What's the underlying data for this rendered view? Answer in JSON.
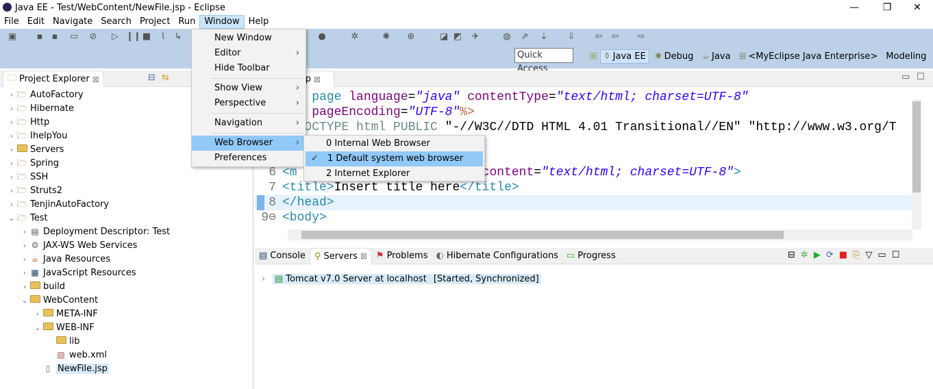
{
  "window": {
    "title": "Java EE - Test/WebContent/NewFile.jsp - Eclipse",
    "minimize": "—",
    "maximize": "❐",
    "close": "✕"
  },
  "menubar": [
    "File",
    "Edit",
    "Navigate",
    "Search",
    "Project",
    "Run",
    "Window",
    "Help"
  ],
  "quick_access": "Quick Access",
  "perspectives": [
    {
      "label": "Java EE",
      "active": true
    },
    {
      "label": "Debug"
    },
    {
      "label": "Java"
    },
    {
      "label": "<MyEclipse Java Enterprise>"
    },
    {
      "label": "Modeling"
    }
  ],
  "project_explorer": {
    "title": "Project Explorer",
    "items": [
      {
        "label": "AutoFactory",
        "level": 0,
        "exp": "›",
        "icon": "project"
      },
      {
        "label": "Hibernate",
        "level": 0,
        "exp": "›",
        "icon": "project"
      },
      {
        "label": "Http",
        "level": 0,
        "exp": "›",
        "icon": "project"
      },
      {
        "label": "IhelpYou",
        "level": 0,
        "exp": "›",
        "icon": "project"
      },
      {
        "label": "Servers",
        "level": 0,
        "exp": "›",
        "icon": "folder"
      },
      {
        "label": "Spring",
        "level": 0,
        "exp": "›",
        "icon": "project"
      },
      {
        "label": "SSH",
        "level": 0,
        "exp": "›",
        "icon": "project"
      },
      {
        "label": "Struts2",
        "level": 0,
        "exp": "›",
        "icon": "project"
      },
      {
        "label": "TenjinAutoFactory",
        "level": 0,
        "exp": "›",
        "icon": "project"
      },
      {
        "label": "Test",
        "level": 0,
        "exp": "⌄",
        "icon": "project"
      },
      {
        "label": "Deployment Descriptor: Test",
        "level": 1,
        "exp": "›",
        "icon": "descriptor"
      },
      {
        "label": "JAX-WS Web Services",
        "level": 1,
        "exp": "›",
        "icon": "ws"
      },
      {
        "label": "Java Resources",
        "level": 1,
        "exp": "›",
        "icon": "jres"
      },
      {
        "label": "JavaScript Resources",
        "level": 1,
        "exp": "›",
        "icon": "js"
      },
      {
        "label": "build",
        "level": 1,
        "exp": "›",
        "icon": "folder"
      },
      {
        "label": "WebContent",
        "level": 1,
        "exp": "⌄",
        "icon": "folder"
      },
      {
        "label": "META-INF",
        "level": 2,
        "exp": "›",
        "icon": "folder"
      },
      {
        "label": "WEB-INF",
        "level": 2,
        "exp": "⌄",
        "icon": "folder"
      },
      {
        "label": "lib",
        "level": 3,
        "exp": "",
        "icon": "folder"
      },
      {
        "label": "web.xml",
        "level": 3,
        "exp": "",
        "icon": "xml"
      },
      {
        "label": "NewFile.jsp",
        "level": 2,
        "exp": "",
        "icon": "file",
        "selected": true
      }
    ]
  },
  "editor": {
    "tab": "sp",
    "lines": [
      {
        "n": "",
        "t": [
          [
            "<%@ ",
            "dl"
          ],
          [
            "page ",
            "tg"
          ],
          [
            "language",
            "at"
          ],
          [
            "=",
            "pl"
          ],
          [
            "\"java\"",
            "st"
          ],
          [
            " contentType",
            "at"
          ],
          [
            "=",
            "pl"
          ],
          [
            "\"text/html; charset=UTF-8\"",
            "st"
          ]
        ]
      },
      {
        "n": "",
        "t": [
          [
            "    pageEncoding",
            "at"
          ],
          [
            "=",
            "pl"
          ],
          [
            "\"UTF-8\"",
            "st"
          ],
          [
            "%>",
            "dl"
          ]
        ]
      },
      {
        "n": "",
        "t": [
          [
            "<!DOCTYPE html PUBLIC ",
            "dt"
          ],
          [
            "\"-//W3C//DTD HTML 4.01 Transitional//EN\" \"http://www.w3.org/T",
            "pl"
          ]
        ]
      },
      {
        "n": "",
        "t": []
      },
      {
        "n": "",
        "t": []
      },
      {
        "n": "6",
        "t": [
          [
            "<m",
            "tg"
          ],
          [
            "                   ",
            "pl"
          ],
          [
            "Type\"",
            "st"
          ],
          [
            " content",
            "at"
          ],
          [
            "=",
            "pl"
          ],
          [
            "\"text/html; charset=UTF-8\"",
            "st"
          ],
          [
            ">",
            "tg"
          ]
        ]
      },
      {
        "n": "7",
        "t": [
          [
            "<title>",
            "tg"
          ],
          [
            "Insert title here",
            "pl"
          ],
          [
            "</title>",
            "tg"
          ]
        ]
      },
      {
        "n": "8",
        "t": [
          [
            "</head>",
            "tg"
          ]
        ],
        "current": true
      },
      {
        "n": "9⊖",
        "t": [
          [
            "<body>",
            "tg"
          ]
        ]
      }
    ]
  },
  "bottom": {
    "tabs": [
      "Console",
      "Servers",
      "Problems",
      "Hibernate Configurations",
      "Progress"
    ],
    "active": 1,
    "server": {
      "name": "Tomcat v7.0 Server at localhost",
      "state": "[Started, Synchronized]"
    }
  },
  "window_menu": {
    "items": [
      {
        "label": "New Window"
      },
      {
        "label": "Editor",
        "sub": true
      },
      {
        "label": "Hide Toolbar"
      },
      {
        "sep": true
      },
      {
        "label": "Show View",
        "sub": true
      },
      {
        "label": "Perspective",
        "sub": true
      },
      {
        "sep": true
      },
      {
        "label": "Navigation",
        "sub": true
      },
      {
        "sep": true
      },
      {
        "label": "Web Browser",
        "sub": true,
        "hl": true
      },
      {
        "label": "Preferences"
      }
    ]
  },
  "web_browser_menu": [
    {
      "label": "0 Internal Web Browser"
    },
    {
      "label": "1 Default system web browser",
      "checked": true
    },
    {
      "label": "2 Internet Explorer"
    }
  ]
}
